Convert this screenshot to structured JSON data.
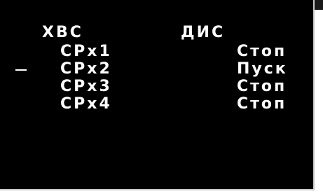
{
  "header": {
    "left_label": "ХВС",
    "right_label": "ДИС"
  },
  "rows": [
    {
      "name": "CPx1",
      "status": "Стоп",
      "selected": false
    },
    {
      "name": "CPx2",
      "status": "Пуск",
      "selected": true
    },
    {
      "name": "CPx3",
      "status": "Стоп",
      "selected": false
    },
    {
      "name": "CPx4",
      "status": "Стоп",
      "selected": false
    }
  ],
  "colors": {
    "background": "#000000",
    "text": "#ffffff",
    "frame": "#c8c8c8"
  }
}
